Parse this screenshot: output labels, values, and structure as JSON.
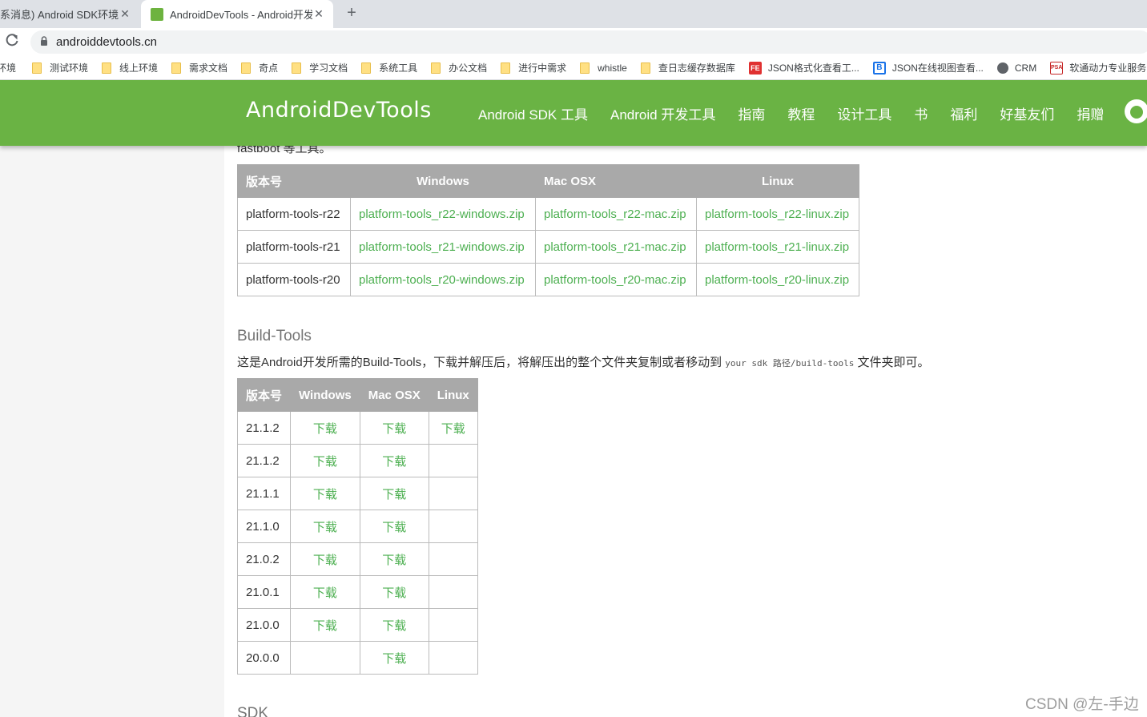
{
  "browser": {
    "tabs": [
      {
        "title": "系消息) Android SDK环境变量",
        "active": false
      },
      {
        "title": "AndroidDevTools - Android开发",
        "active": true
      }
    ],
    "close_glyph": "✕",
    "newtab_glyph": "+",
    "reload_glyph": "C",
    "lock_glyph": "🔒",
    "url": "androiddevtools.cn",
    "bookmarks": [
      {
        "label": "环境",
        "icon": "none"
      },
      {
        "label": "测试环境",
        "icon": "folder"
      },
      {
        "label": "线上环境",
        "icon": "folder"
      },
      {
        "label": "需求文档",
        "icon": "folder"
      },
      {
        "label": "奇点",
        "icon": "folder"
      },
      {
        "label": "学习文档",
        "icon": "folder"
      },
      {
        "label": "系统工具",
        "icon": "folder"
      },
      {
        "label": "办公文档",
        "icon": "folder"
      },
      {
        "label": "进行中需求",
        "icon": "folder"
      },
      {
        "label": "whistle",
        "icon": "folder"
      },
      {
        "label": "查日志缓存数据库",
        "icon": "folder"
      },
      {
        "label": "JSON格式化查看工...",
        "icon": "fe"
      },
      {
        "label": "JSON在线视图查看...",
        "icon": "b"
      },
      {
        "label": "CRM",
        "icon": "globe"
      },
      {
        "label": "软通动力专业服务",
        "icon": "psa"
      }
    ],
    "icon_text": {
      "fe": "FE",
      "b": "B",
      "psa": "PSA"
    }
  },
  "site": {
    "logo": "AndroidDevTools",
    "brand_color": "#6ab344",
    "link_color": "#4caf50",
    "nav": [
      "Android SDK 工具",
      "Android 开发工具",
      "指南",
      "教程",
      "设计工具",
      "书",
      "福利",
      "好基友们",
      "捐赠"
    ]
  },
  "content": {
    "intro_tail": "fastboot 等工具。",
    "platform_tools": {
      "headers": [
        "版本号",
        "Windows",
        "Mac OSX",
        "Linux"
      ],
      "rows": [
        [
          "platform-tools-r22",
          "platform-tools_r22-windows.zip",
          "platform-tools_r22-mac.zip",
          "platform-tools_r22-linux.zip"
        ],
        [
          "platform-tools-r21",
          "platform-tools_r21-windows.zip",
          "platform-tools_r21-mac.zip",
          "platform-tools_r21-linux.zip"
        ],
        [
          "platform-tools-r20",
          "platform-tools_r20-windows.zip",
          "platform-tools_r20-mac.zip",
          "platform-tools_r20-linux.zip"
        ]
      ]
    },
    "build_tools": {
      "heading": "Build-Tools",
      "desc_before": "这是Android开发所需的Build-Tools，下载并解压后，将解压出的整个文件夹复制或者移动到 ",
      "desc_code": "your sdk 路径/build-tools",
      "desc_after": " 文件夹即可。",
      "headers": [
        "版本号",
        "Windows",
        "Mac OSX",
        "Linux"
      ],
      "rows": [
        [
          "21.1.2",
          "下载",
          "下载",
          "下载"
        ],
        [
          "21.1.2",
          "下载",
          "下载",
          ""
        ],
        [
          "21.1.1",
          "下载",
          "下载",
          ""
        ],
        [
          "21.1.0",
          "下载",
          "下载",
          ""
        ],
        [
          "21.0.2",
          "下载",
          "下载",
          ""
        ],
        [
          "21.0.1",
          "下载",
          "下载",
          ""
        ],
        [
          "21.0.0",
          "下载",
          "下载",
          ""
        ],
        [
          "20.0.0",
          "",
          "下载",
          ""
        ]
      ]
    },
    "sdk_heading": "SDK",
    "watermark": "CSDN @左-手边"
  }
}
